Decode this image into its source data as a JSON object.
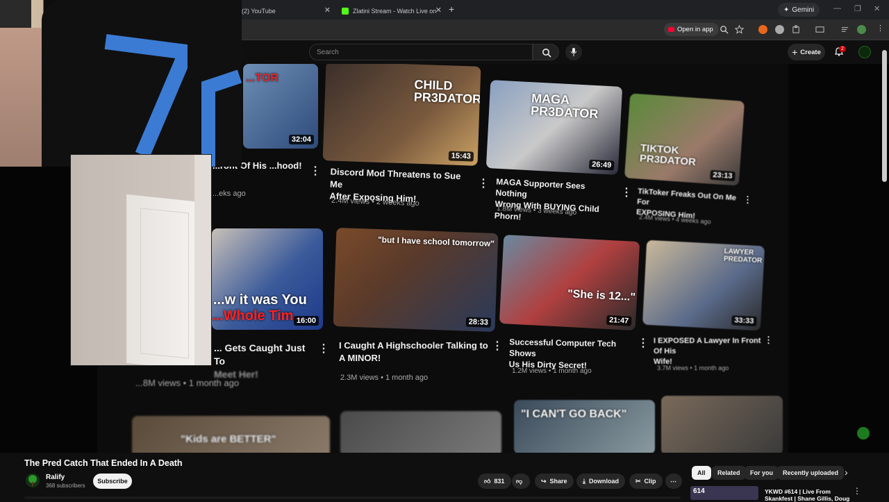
{
  "browser": {
    "tabs": [
      {
        "label": "(2) YouTube"
      },
      {
        "label": "Zlatini Stream - Watch Live on "
      }
    ],
    "gemini_label": "Gemini",
    "open_in_app_label": "Open in app"
  },
  "masthead": {
    "search_placeholder": "Search",
    "create_label": "Create",
    "notification_count": "2"
  },
  "grid": {
    "row1": [
      {
        "title": "...ront Of His ...hood!",
        "meta": "...eks ago",
        "duration": "32:04",
        "overlay": "...TOR"
      },
      {
        "title_line1": "Discord Mod Threatens to Sue Me",
        "title_line2": "After Exposing Him!",
        "meta": "2.4M views • 2 weeks ago",
        "duration": "15:43",
        "overlay": "CHILD PR3DATOR"
      },
      {
        "title_line1": "MAGA Supporter Sees Nothing",
        "title_line2": "Wrong With BUYING Child Phorn!",
        "meta": "1.8M views • 3 weeks ago",
        "duration": "26:49",
        "overlay": "MAGA PR3DATOR"
      },
      {
        "title_line1": "TikToker Freaks Out On Me For",
        "title_line2": "EXPOSING Him!",
        "meta": "2.4M views • 4 weeks ago",
        "duration": "23:13",
        "overlay": "TIKTOK PR3DATOR"
      }
    ],
    "row2": [
      {
        "title_line1": "... Gets Caught Just To",
        "title_line2": "Meet Her!",
        "meta": "...8M views • 1 month ago",
        "duration": "16:00",
        "overlay1": "...w it was You",
        "overlay2": "...Whole Tim..."
      },
      {
        "title_line1": "I Caught A Highschooler Talking to",
        "title_line2": "A MINOR!",
        "meta": "2.3M views • 1 month ago",
        "duration": "28:33",
        "overlay": "\"but I have school tomorrow\""
      },
      {
        "title_line1": "Successful Computer Tech Shows",
        "title_line2": "Us His Dirty Secret!",
        "meta": "1.2M views • 1 month ago",
        "duration": "21:47",
        "overlay": "\"She is 12...\""
      },
      {
        "title_line1": "I EXPOSED A Lawyer In Front Of His",
        "title_line2": "Wife!",
        "meta": "3.7M views • 1 month ago",
        "duration": "33:33",
        "overlay": "LAWYER PREDATOR"
      }
    ],
    "row3": [
      {
        "overlay": "\"Kids are BETTER\""
      },
      {
        "overlay": ""
      },
      {
        "overlay": "\"I CAN'T GO BACK\""
      },
      {
        "overlay": ""
      }
    ]
  },
  "video": {
    "title": "The Pred Catch That Ended In A Death",
    "channel": "Ralify",
    "subscribers": "368 subscribers",
    "subscribe_label": "Subscribe",
    "likes": "831",
    "share_label": "Share",
    "download_label": "Download",
    "clip_label": "Clip"
  },
  "chips": [
    "All",
    "Related",
    "For you",
    "Recently uploaded"
  ],
  "up_next": {
    "title_line1": "YKWD #614 | Live From",
    "title_line2": "Skankfest | Shane Gillis, Doug",
    "thumb_text": "614"
  },
  "colors": {
    "accent_red": "#ff0033",
    "bg": "#0f0f0f"
  }
}
